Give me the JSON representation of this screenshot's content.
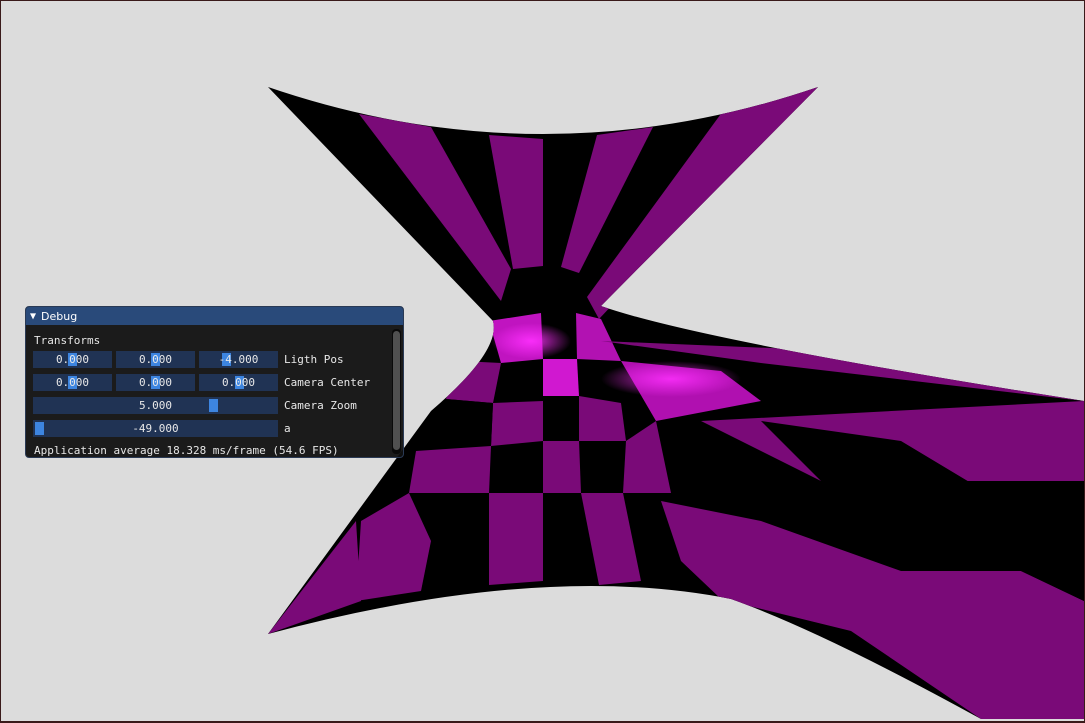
{
  "window": {
    "title": "Debug",
    "section": "Transforms",
    "rows": [
      {
        "label": "Ligth Pos",
        "values": [
          "0.000",
          "0.000",
          "-4.000"
        ]
      },
      {
        "label": "Camera Center",
        "values": [
          "0.000",
          "0.000",
          "0.000"
        ]
      },
      {
        "label": "Camera Zoom",
        "value": "5.000"
      },
      {
        "label": "a",
        "value": "-49.000"
      }
    ],
    "status": "Application average 18.328 ms/frame (54.6 FPS)"
  },
  "colors": {
    "background": "#dcdcdc",
    "checker_magenta": "#7a0a78",
    "checker_black": "#000000",
    "highlight": "#ff10ff",
    "title_bar": "#294a7a",
    "frame_bg": "#203354",
    "slider_grab": "#3d85e0"
  }
}
